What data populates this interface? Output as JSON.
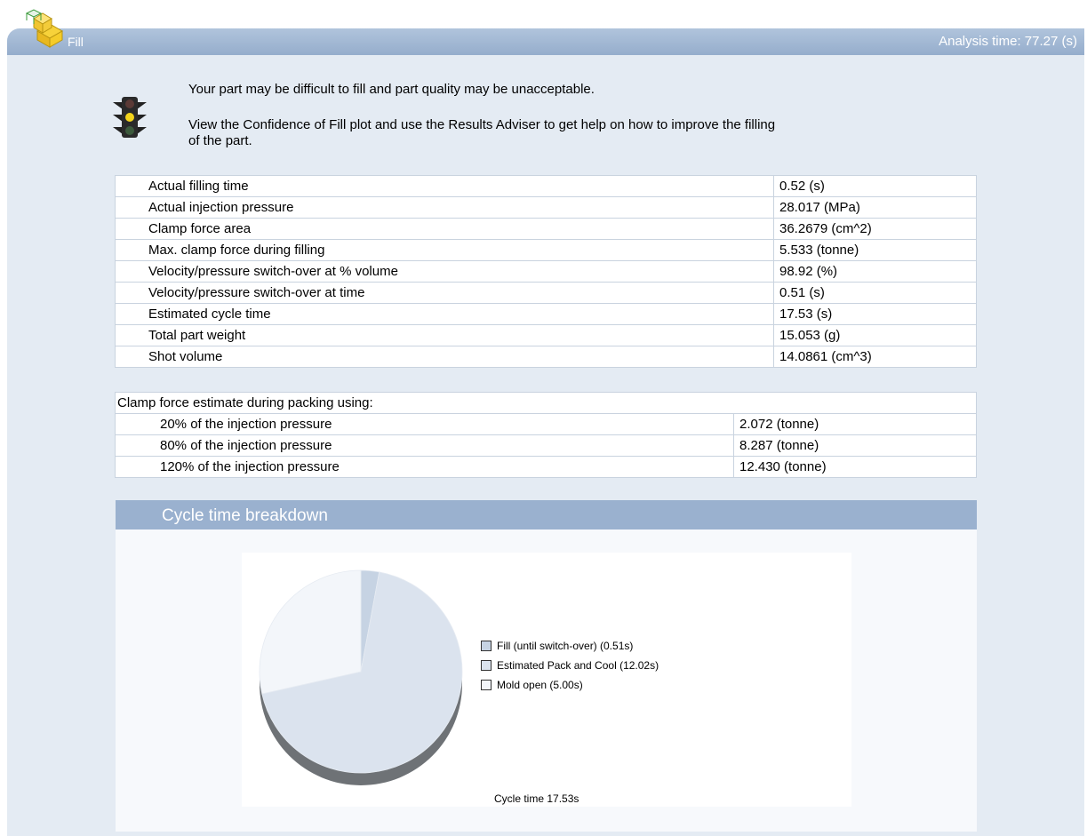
{
  "header": {
    "title": "Fill",
    "analysis_time": "Analysis time: 77.27 (s)"
  },
  "icons": {
    "logo": "part-cube-icon",
    "status": "traffic-light-icon"
  },
  "message": {
    "line1": "Your part may be difficult to fill and part quality may be unacceptable.",
    "line2a": "View the Confidence of Fill plot and use the Results Adviser to get help on how to improve the filling",
    "line2b": "of the part."
  },
  "results": [
    {
      "label": "Actual filling time",
      "value": "0.52 (s)"
    },
    {
      "label": "Actual injection pressure",
      "value": "28.017 (MPa)"
    },
    {
      "label": "Clamp force area",
      "value": "36.2679 (cm^2)"
    },
    {
      "label": "Max. clamp force during filling",
      "value": "5.533 (tonne)"
    },
    {
      "label": "Velocity/pressure switch-over at % volume",
      "value": "98.92 (%)"
    },
    {
      "label": "Velocity/pressure switch-over at time",
      "value": "0.51 (s)"
    },
    {
      "label": "Estimated cycle time",
      "value": "17.53 (s)"
    },
    {
      "label": "Total part weight",
      "value": "15.053 (g)"
    },
    {
      "label": "Shot volume",
      "value": "14.0861 (cm^3)"
    }
  ],
  "clamp": {
    "heading": "Clamp force estimate during packing using:",
    "rows": [
      {
        "label": "20% of the injection pressure",
        "value": "2.072 (tonne)"
      },
      {
        "label": "80% of the injection pressure",
        "value": "8.287 (tonne)"
      },
      {
        "label": "120% of the injection pressure",
        "value": "12.430 (tonne)"
      }
    ]
  },
  "cycle": {
    "title": "Cycle time breakdown"
  },
  "chart_data": {
    "type": "pie",
    "title": "",
    "caption": "Cycle time 17.53s",
    "slices": [
      {
        "name": "Fill (until switch-over) (0.51s)",
        "value": 0.51,
        "color": "#c6d3e3"
      },
      {
        "name": "Estimated Pack and Cool (12.02s)",
        "value": 12.02,
        "color": "#dbe3ee"
      },
      {
        "name": "Mold open (5.00s)",
        "value": 5.0,
        "color": "#f3f6fa"
      }
    ],
    "legend": "right"
  }
}
